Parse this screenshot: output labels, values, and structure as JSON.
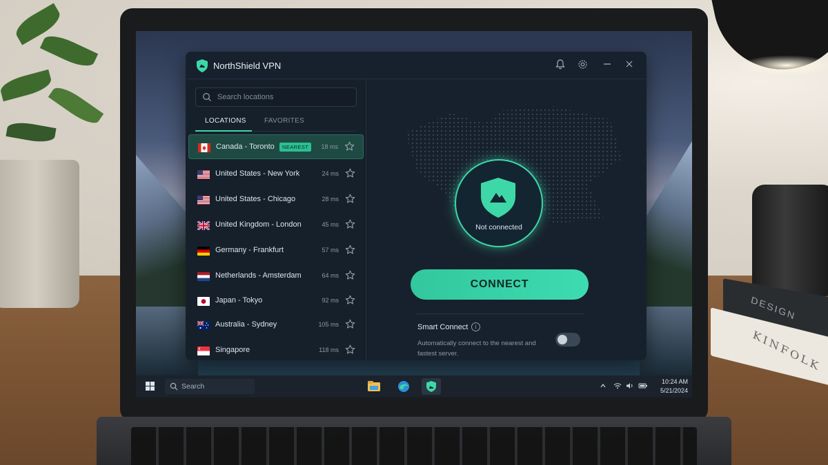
{
  "app": {
    "title": "NorthShield VPN",
    "accent_color": "#3ED8A8"
  },
  "titlebar": {
    "icons": [
      "bell-icon",
      "gear-icon",
      "minimize-icon",
      "close-icon"
    ]
  },
  "sidebar": {
    "search_placeholder": "Search locations",
    "tabs": [
      {
        "label": "LOCATIONS",
        "active": true
      },
      {
        "label": "FAVORITES",
        "active": false
      }
    ],
    "locations": [
      {
        "name": "Canada - Toronto",
        "ping": "18 ms",
        "badge": "NEAREST",
        "selected": true,
        "flag": "ca"
      },
      {
        "name": "United States - New York",
        "ping": "24 ms",
        "flag": "us"
      },
      {
        "name": "United States - Chicago",
        "ping": "28 ms",
        "flag": "us"
      },
      {
        "name": "United Kingdom - London",
        "ping": "45 ms",
        "flag": "gb"
      },
      {
        "name": "Germany - Frankfurt",
        "ping": "57 ms",
        "flag": "de"
      },
      {
        "name": "Netherlands - Amsterdam",
        "ping": "64 ms",
        "flag": "nl"
      },
      {
        "name": "Japan - Tokyo",
        "ping": "92 ms",
        "flag": "jp"
      },
      {
        "name": "Australia - Sydney",
        "ping": "105 ms",
        "flag": "au"
      },
      {
        "name": "Singapore",
        "ping": "118 ms",
        "flag": "sg"
      }
    ]
  },
  "main": {
    "status": "Not connected",
    "connect_label": "CONNECT",
    "smart_connect": {
      "title": "Smart Connect",
      "description": "Automatically connect to the nearest and fastest server.",
      "enabled": false
    }
  },
  "taskbar": {
    "search_label": "Search",
    "time": "10:24 AM",
    "date": "5/21/2024"
  },
  "room": {
    "book_top": "DESIGN",
    "book_bottom": "KINFOLK"
  }
}
